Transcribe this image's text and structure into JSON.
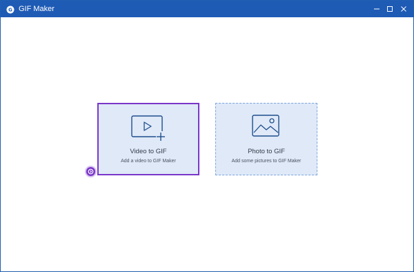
{
  "window": {
    "title": "GIF Maker",
    "controls": [
      "minimize",
      "maximize",
      "close"
    ]
  },
  "cards": [
    {
      "title": "Video to GIF",
      "subtitle": "Add a video to GIF Maker",
      "icon": "video-add-icon",
      "state": "selected"
    },
    {
      "title": "Photo to GIF",
      "subtitle": "Add some pictures to GIF Maker",
      "icon": "photo-icon",
      "state": "normal"
    }
  ],
  "colors": {
    "titlebar": "#1e5bb5",
    "card_bg": "#dfe9f8",
    "selected_border": "#7a36c9",
    "dashed_border": "#7ea6dd",
    "icon_stroke": "#1f4e8c"
  },
  "step_marker": {
    "icon": "circle-arrow-icon"
  }
}
